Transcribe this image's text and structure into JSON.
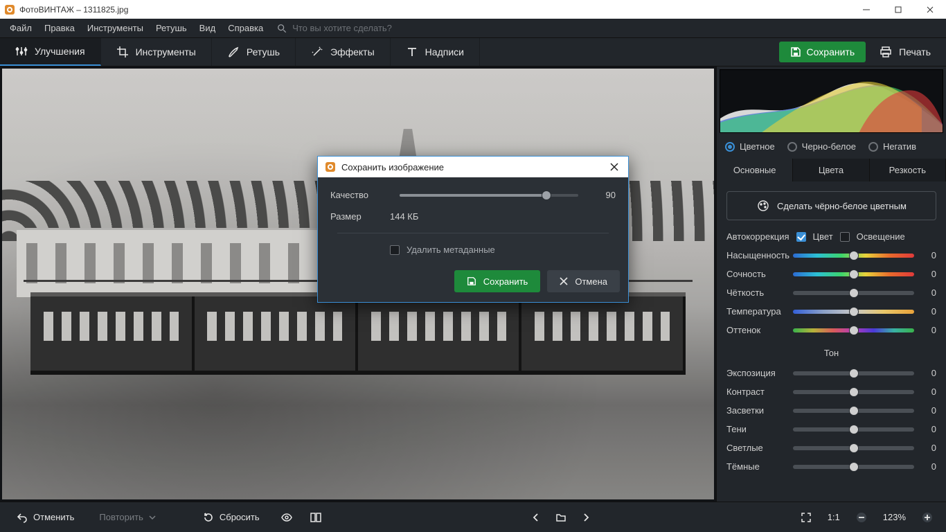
{
  "app": {
    "title": "ФотоВИНТАЖ – 1311825.jpg"
  },
  "menu": [
    "Файл",
    "Правка",
    "Инструменты",
    "Ретушь",
    "Вид",
    "Справка"
  ],
  "search_placeholder": "Что вы хотите сделать?",
  "modes": {
    "enhance": "Улучшения",
    "tools": "Инструменты",
    "retouch": "Ретушь",
    "effects": "Эффекты",
    "captions": "Надписи"
  },
  "actions": {
    "save": "Сохранить",
    "print": "Печать"
  },
  "color_mode": {
    "color": "Цветное",
    "bw": "Черно-белое",
    "negative": "Негатив"
  },
  "adjust_tabs": {
    "basic": "Основные",
    "colors": "Цвета",
    "sharp": "Резкость"
  },
  "bw_colorize": "Сделать чёрно-белое цветным",
  "auto": {
    "label": "Автокоррекция",
    "color": "Цвет",
    "light": "Освещение"
  },
  "sliders": {
    "saturation": {
      "label": "Насыщенность",
      "value": "0"
    },
    "vibrance": {
      "label": "Сочность",
      "value": "0"
    },
    "clarity": {
      "label": "Чёткость",
      "value": "0"
    },
    "temperature": {
      "label": "Температура",
      "value": "0"
    },
    "hue": {
      "label": "Оттенок",
      "value": "0"
    },
    "tone_heading": "Тон",
    "exposure": {
      "label": "Экспозиция",
      "value": "0"
    },
    "contrast": {
      "label": "Контраст",
      "value": "0"
    },
    "highlights": {
      "label": "Засветки",
      "value": "0"
    },
    "shadows": {
      "label": "Тени",
      "value": "0"
    },
    "whites": {
      "label": "Светлые",
      "value": "0"
    },
    "blacks": {
      "label": "Тёмные",
      "value": "0"
    }
  },
  "bottom": {
    "undo": "Отменить",
    "redo": "Повторить",
    "reset": "Сбросить",
    "ratio": "1:1",
    "zoom": "123%"
  },
  "dialog": {
    "title": "Сохранить изображение",
    "quality_label": "Качество",
    "quality_value": "90",
    "quality_percent": 90,
    "size_label": "Размер",
    "size_value": "144 КБ",
    "strip_meta": "Удалить метаданные",
    "save": "Сохранить",
    "cancel": "Отмена"
  }
}
